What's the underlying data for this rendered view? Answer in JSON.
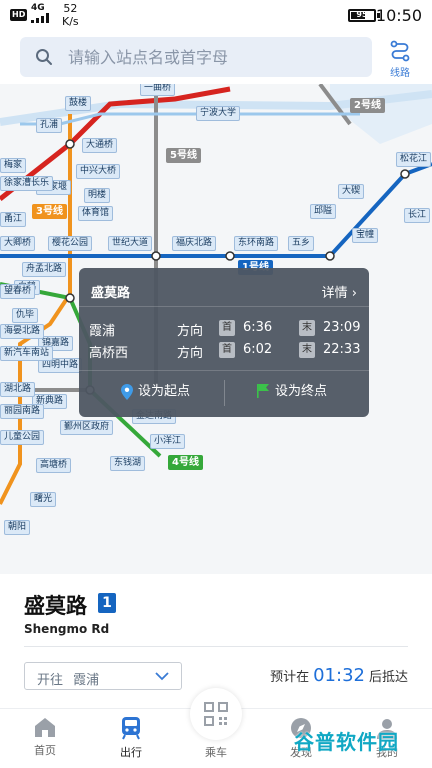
{
  "status_bar": {
    "hd": "HD",
    "network": "4G",
    "speed_value": "52",
    "speed_unit": "K/s",
    "battery": "95",
    "time": "10:50"
  },
  "search": {
    "placeholder": "请输入站点名或首字母"
  },
  "routes_button": {
    "label": "线路"
  },
  "map": {
    "line_badges": [
      {
        "label": "2号线",
        "color": "#8c8c8c"
      },
      {
        "label": "5号线",
        "color": "#8c8c8c"
      },
      {
        "label": "3号线",
        "color": "#f0931e"
      },
      {
        "label": "1号线",
        "color": "#1565c0"
      },
      {
        "label": "4号线",
        "color": "#35a83a"
      }
    ],
    "stations": [
      "一曲桥",
      "鼓楼",
      "宁波大学",
      "孔浦",
      "大通桥",
      "中兴大桥",
      "梅家",
      "倪家堰",
      "明楼",
      "体育馆",
      "大卿桥",
      "樱花公园",
      "世纪大道",
      "福庆北路",
      "东环南路",
      "五乡",
      "舟孟北路",
      "邱隘",
      "宝幢",
      "长江",
      "松花江",
      "大碶",
      "甬江",
      "白鹤",
      "仇毕",
      "锦嘉路",
      "四明中路",
      "新典路",
      "丽园南路",
      "高塘桥",
      "曙光",
      "朝阳",
      "海晏北路",
      "小洋江",
      "东钱湖",
      "徐家漕长乐",
      "儿童公园",
      "新汽车南站",
      "鄞州区政府",
      "金达南路",
      "湖北路",
      "望春桥"
    ]
  },
  "popup": {
    "station": "盛莫路",
    "detail_label": "详情",
    "directions": [
      {
        "to": "霞浦",
        "word": "方向",
        "first_tag": "首",
        "first_time": "6:36",
        "last_tag": "末",
        "last_time": "23:09"
      },
      {
        "to": "高桥西",
        "word": "方向",
        "first_tag": "首",
        "first_time": "6:02",
        "last_tag": "末",
        "last_time": "22:33"
      }
    ],
    "set_start": "设为起点",
    "set_end": "设为终点"
  },
  "station_sheet": {
    "name": "盛莫路",
    "line_number": "1",
    "name_en": "Shengmo Rd",
    "direction_prefix": "开往",
    "direction_value": "霞浦",
    "eta_prefix": "预计在",
    "eta_time": "01:32",
    "eta_suffix": "后抵达"
  },
  "tabs": [
    {
      "label": "首页",
      "icon": "home-icon"
    },
    {
      "label": "出行",
      "icon": "metro-icon"
    },
    {
      "label": "乘车",
      "icon": "qr-code-icon"
    },
    {
      "label": "发现",
      "icon": "discover-icon"
    },
    {
      "label": "我的",
      "icon": "profile-icon"
    }
  ],
  "watermark": "谷普软件园",
  "colors": {
    "line1": "#1565c0",
    "line2": "#8c8c8c",
    "line3": "#f0931e",
    "line4": "#35a83a",
    "red_line": "#d6241f",
    "accent": "#1e6fd9"
  }
}
